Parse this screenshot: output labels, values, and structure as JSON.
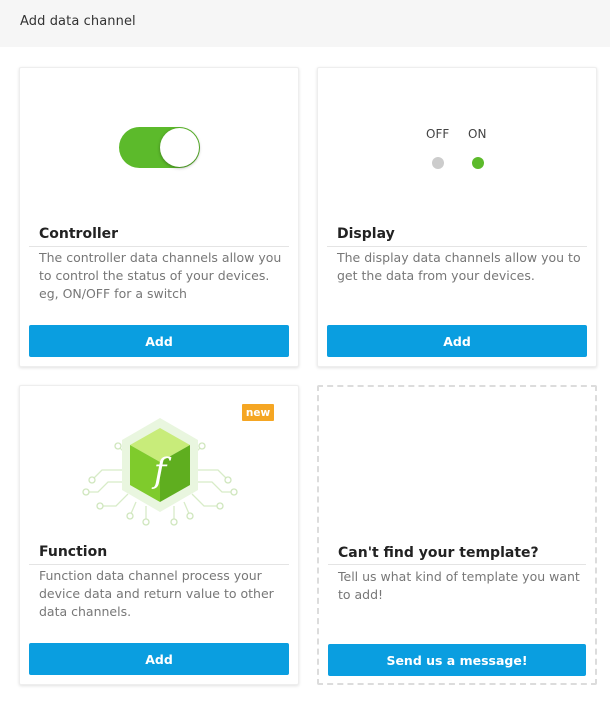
{
  "header": {
    "title": "Add data channel"
  },
  "cards": [
    {
      "title": "Controller",
      "description": "The controller data channels allow you to control the status of your devices. eg, ON/OFF for a switch",
      "button": "Add",
      "icon": "toggle-switch-icon"
    },
    {
      "title": "Display",
      "description": "The display data channels allow you to get the data from your devices.",
      "button": "Add",
      "labels": {
        "off": "OFF",
        "on": "ON"
      },
      "icon": "status-dots-icon"
    },
    {
      "title": "Function",
      "badge": "new",
      "description": "Function data channel process your device data and return value to other data channels.",
      "button": "Add",
      "icon": "function-cube-icon"
    },
    {
      "title": "Can't find your template?",
      "description": "Tell us what kind of template you want to add!",
      "button": "Send us a message!"
    }
  ],
  "colors": {
    "accent": "#0a9ee0",
    "toggle_on": "#5cba2b",
    "dot_off": "#cccccc",
    "dot_on": "#5cba2b",
    "badge": "#f5a623"
  }
}
